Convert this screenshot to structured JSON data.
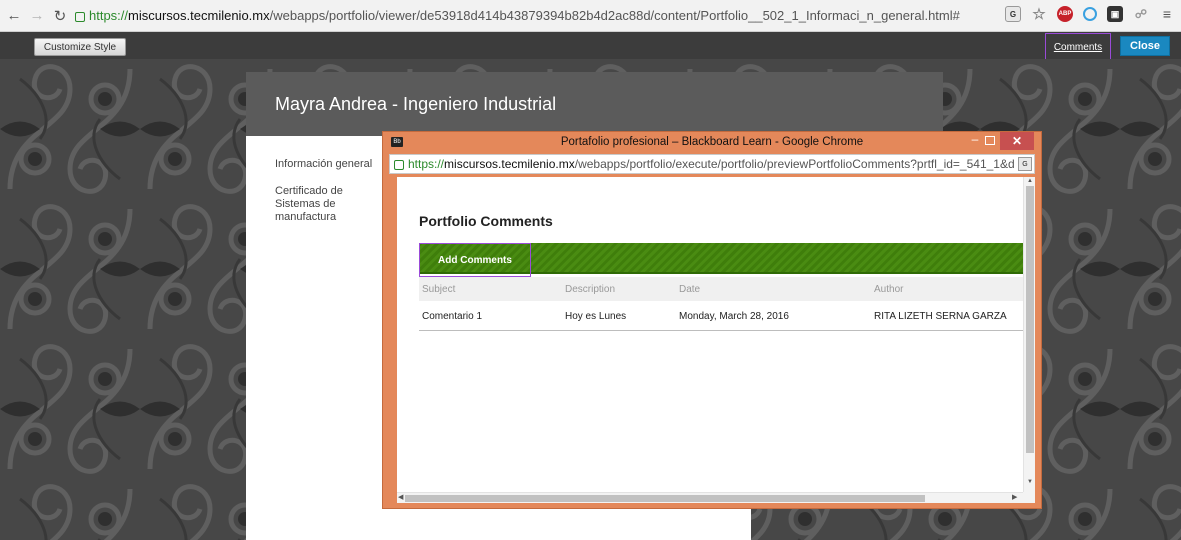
{
  "browser": {
    "url_https": "https://",
    "url_domain": "miscursos.tecmilenio.mx",
    "url_path": "/webapps/portfolio/viewer/de53918d414b43879394b82b4d2ac88d/content/Portfolio__502_1_Informaci_n_general.html#",
    "icons": [
      "back-icon",
      "forward-icon",
      "reload-icon",
      "lock-icon",
      "translate-icon",
      "star-icon",
      "adblock-icon",
      "sync-icon",
      "extension-icon",
      "extension-icon",
      "menu-icon"
    ],
    "abp_label": "ABP"
  },
  "toolbar": {
    "customize_label": "Customize Style",
    "comments_label": "Comments",
    "close_label": "Close"
  },
  "page": {
    "title": "Mayra Andrea - Ingeniero Industrial",
    "nav_items": [
      {
        "label": "Información general"
      },
      {
        "label": "Certificado de Sistemas de manufactura"
      }
    ]
  },
  "popup": {
    "window_title": "Portafolio profesional – Blackboard Learn - Google Chrome",
    "app_icon_label": "Bb",
    "url_https": "https://",
    "url_domain": "miscursos.tecmilenio.mx",
    "url_path": "/webapps/portfolio/execute/portfolio/previewPortfolioComments?prtfl_id=_541_1&d",
    "heading": "Portfolio Comments",
    "add_comments_label": "Add Comments",
    "table": {
      "headers": [
        "Subject",
        "Description",
        "Date",
        "Author"
      ],
      "rows": [
        [
          "Comentario 1",
          "Hoy es Lunes",
          "Monday, March 28, 2016",
          "RITA LIZETH SERNA GARZA"
        ]
      ]
    }
  },
  "colors": {
    "accent_close": "#1a88c0",
    "popup_frame": "#e4885a",
    "green_bar": "#4a8c12",
    "highlight": "#9a4bd8",
    "secure_green": "#2b8a2b"
  }
}
